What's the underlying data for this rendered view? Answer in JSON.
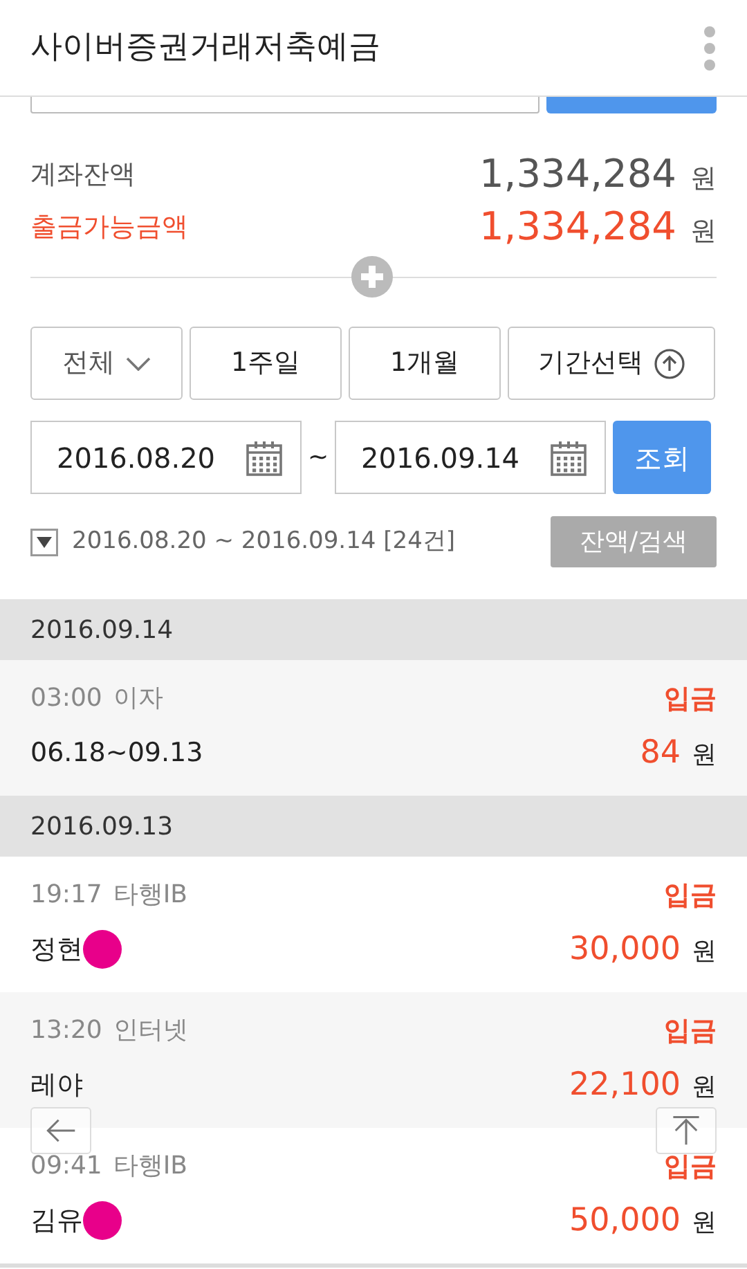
{
  "header": {
    "title": "사이버증권거래저축예금"
  },
  "balances": [
    {
      "label": "계좌잔액",
      "amount": "1,334,284",
      "unit": "원",
      "kind": "normal"
    },
    {
      "label": "출금가능금액",
      "amount": "1,334,284",
      "unit": "원",
      "kind": "highlight"
    }
  ],
  "filters": [
    {
      "label": "전체",
      "kind": "dropdown"
    },
    {
      "label": "1주일",
      "kind": "plain"
    },
    {
      "label": "1개월",
      "kind": "plain"
    },
    {
      "label": "기간선택",
      "kind": "toggle"
    }
  ],
  "date_range": {
    "from": "2016.08.20",
    "separator": "~",
    "to": "2016.09.14",
    "button": "조회"
  },
  "summary": {
    "text": "2016.08.20 ~ 2016.09.14 [24건]",
    "button": "잔액/검색"
  },
  "groups": [
    {
      "date": "2016.09.14",
      "rows": [
        {
          "time": "03:00",
          "channel": "이자",
          "memo": "06.18~09.13",
          "type": "입금",
          "amount": "84",
          "unit": "원",
          "masked": false
        }
      ]
    },
    {
      "date": "2016.09.13",
      "rows": [
        {
          "time": "19:17",
          "channel": "타행IB",
          "memo": "정현",
          "type": "입금",
          "amount": "30,000",
          "unit": "원",
          "masked": true
        },
        {
          "time": "13:20",
          "channel": "인터넷",
          "memo": "레야",
          "type": "입금",
          "amount": "22,100",
          "unit": "원",
          "masked": false
        },
        {
          "time": "09:41",
          "channel": "타행IB",
          "memo": "김유",
          "type": "입금",
          "amount": "50,000",
          "unit": "원",
          "masked": true
        }
      ]
    }
  ]
}
